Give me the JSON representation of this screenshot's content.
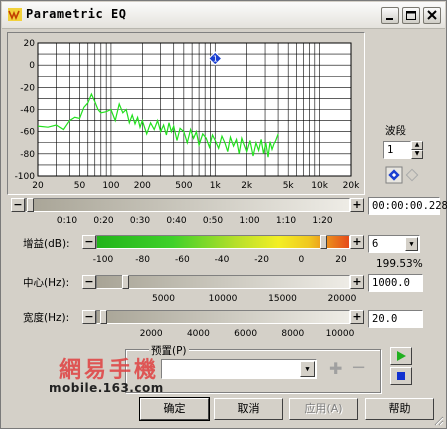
{
  "window": {
    "title": "Parametric EQ"
  },
  "chart_data": {
    "type": "line",
    "ylim": [
      -100,
      20
    ],
    "xlim": [
      20,
      20000
    ],
    "x_scale": "log",
    "grid": true,
    "yticks": [
      "20",
      "0",
      "-20",
      "-40",
      "-60",
      "-80",
      "-100"
    ],
    "xticks": [
      "20",
      "50",
      "100",
      "200",
      "500",
      "1k",
      "2k",
      "5k",
      "10k",
      "20k"
    ],
    "band_marker": {
      "label": "1",
      "x": 1000,
      "y": 6
    },
    "spectrum": [
      [
        20,
        -55
      ],
      [
        25,
        -56
      ],
      [
        30,
        -54
      ],
      [
        35,
        -58
      ],
      [
        40,
        -50
      ],
      [
        45,
        -47
      ],
      [
        50,
        -48
      ],
      [
        55,
        -38
      ],
      [
        60,
        -34
      ],
      [
        65,
        -26
      ],
      [
        70,
        -33
      ],
      [
        75,
        -40
      ],
      [
        80,
        -43
      ],
      [
        90,
        -42
      ],
      [
        100,
        -40
      ],
      [
        110,
        -50
      ],
      [
        120,
        -35
      ],
      [
        130,
        -43
      ],
      [
        140,
        -40
      ],
      [
        150,
        -52
      ],
      [
        160,
        -45
      ],
      [
        170,
        -53
      ],
      [
        180,
        -47
      ],
      [
        190,
        -56
      ],
      [
        200,
        -50
      ],
      [
        220,
        -62
      ],
      [
        240,
        -52
      ],
      [
        260,
        -58
      ],
      [
        280,
        -50
      ],
      [
        300,
        -60
      ],
      [
        320,
        -54
      ],
      [
        340,
        -63
      ],
      [
        360,
        -52
      ],
      [
        380,
        -60
      ],
      [
        400,
        -55
      ],
      [
        430,
        -68
      ],
      [
        460,
        -57
      ],
      [
        500,
        -60
      ],
      [
        540,
        -70
      ],
      [
        580,
        -58
      ],
      [
        620,
        -66
      ],
      [
        660,
        -60
      ],
      [
        700,
        -72
      ],
      [
        760,
        -62
      ],
      [
        820,
        -66
      ],
      [
        880,
        -74
      ],
      [
        940,
        -63
      ],
      [
        1000,
        -68
      ],
      [
        1080,
        -75
      ],
      [
        1160,
        -64
      ],
      [
        1240,
        -70
      ],
      [
        1320,
        -78
      ],
      [
        1400,
        -65
      ],
      [
        1500,
        -73
      ],
      [
        1600,
        -67
      ],
      [
        1700,
        -80
      ],
      [
        1800,
        -66
      ],
      [
        1900,
        -72
      ],
      [
        2000,
        -78
      ],
      [
        2150,
        -68
      ],
      [
        2300,
        -82
      ],
      [
        2450,
        -70
      ],
      [
        2600,
        -77
      ],
      [
        2750,
        -67
      ],
      [
        2900,
        -80
      ],
      [
        3050,
        -70
      ],
      [
        3200,
        -83
      ],
      [
        3350,
        -69
      ],
      [
        3500,
        -76
      ],
      [
        3650,
        -71
      ],
      [
        3800,
        -68
      ],
      [
        4000,
        -62
      ]
    ]
  },
  "band": {
    "label": "波段",
    "value": "1"
  },
  "time_slider": {
    "ticks": [
      "0:10",
      "0:20",
      "0:30",
      "0:40",
      "0:50",
      "1:00",
      "1:10",
      "1:20"
    ],
    "position_fraction": 0.0,
    "time_value": "00:00:00.228"
  },
  "gain": {
    "label": "增益(dB):",
    "ticks": [
      "-100",
      "-80",
      "-60",
      "-40",
      "-20",
      "0",
      "20"
    ],
    "value": "6",
    "percent": "199.53%",
    "position_db": 6
  },
  "center": {
    "label": "中心(Hz):",
    "ticks": [
      "5000",
      "10000",
      "15000",
      "20000"
    ],
    "value": "1000.0",
    "position_hz": 1000
  },
  "width": {
    "label": "宽度(Hz):",
    "ticks": [
      "2000",
      "4000",
      "6000",
      "8000",
      "10000"
    ],
    "value": "20.0",
    "position_hz": 20
  },
  "preset": {
    "label": "预置(P)",
    "value": ""
  },
  "watermark": {
    "brand": "網易手機",
    "url": "mobile.163.com"
  },
  "buttons": {
    "ok": "确定",
    "cancel": "取消",
    "apply": "应用(A)",
    "help": "帮助"
  },
  "colors": {
    "spectrum": "#22e01e",
    "marker": "#1a3fd1",
    "play": "#20b020",
    "stop": "#1030d0"
  }
}
